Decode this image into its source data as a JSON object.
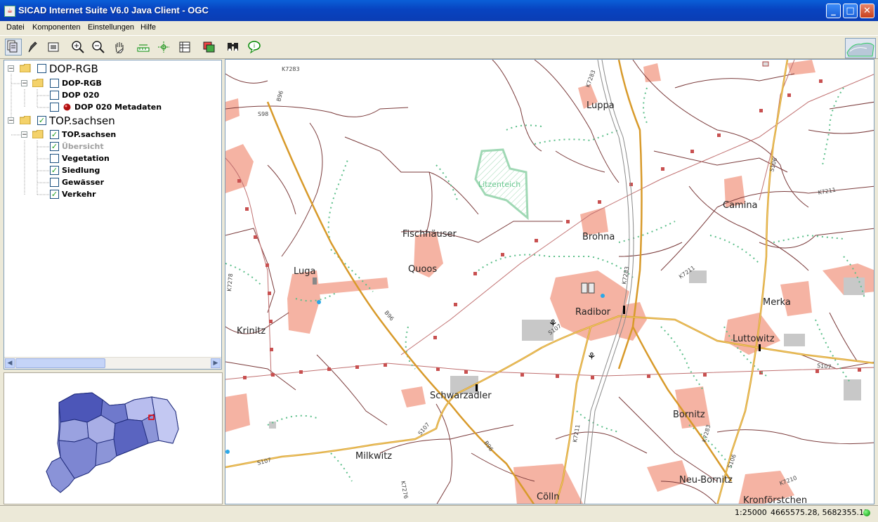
{
  "window": {
    "title": "SICAD Internet Suite V6.0 Java Client - OGC"
  },
  "menu": [
    "Datei",
    "Komponenten",
    "Einstellungen",
    "Hilfe"
  ],
  "tree": {
    "root1": {
      "label": "DOP-RGB",
      "checked": false
    },
    "root1_group": {
      "label": "DOP-RGB",
      "checked": false
    },
    "dop020": {
      "label": "DOP 020",
      "checked": false
    },
    "dop020meta": {
      "label": "DOP 020 Metadaten",
      "checked": false
    },
    "root2": {
      "label": "TOP.sachsen",
      "checked": true
    },
    "root2_group": {
      "label": "TOP.sachsen",
      "checked": true
    },
    "uebersicht": {
      "label": "Übersicht",
      "checked": true
    },
    "vegetation": {
      "label": "Vegetation",
      "checked": false
    },
    "siedlung": {
      "label": "Siedlung",
      "checked": true
    },
    "gewaesser": {
      "label": "Gewässer",
      "checked": false
    },
    "verkehr": {
      "label": "Verkehr",
      "checked": true
    }
  },
  "map": {
    "places": {
      "luppa": "Luppa",
      "camina": "Camina",
      "fischhaeuser": "Fischhäuser",
      "brohna": "Brohna",
      "luga": "Luga",
      "quoos": "Quoos",
      "radibor": "Radibor",
      "merka": "Merka",
      "krinitz": "Krinitz",
      "luttowitz": "Luttowitz",
      "schwarzadler": "Schwarzadler",
      "bornitz": "Bornitz",
      "milkwitz": "Milkwitz",
      "neu_bornitz": "Neu-Bornitz",
      "kronfoerstchen": "Kronförstchen",
      "coelln": "Cölln",
      "litzenteich": "Litzenteich"
    },
    "roads": {
      "k7283a": "K7283",
      "b96a": "B96",
      "s98": "S98",
      "k7283b": "K7283",
      "s106a": "S106",
      "k7211a": "K7211",
      "k7278": "K7278",
      "k7211b": "K7211",
      "k7283c": "K7283",
      "b96b": "B96",
      "s107a": "S107",
      "s107b": "S107",
      "s107c": "S107",
      "k7211c": "K7211",
      "k7283d": "K7283",
      "s107d": "S107",
      "b96c": "B96",
      "k7276": "K7276",
      "s106b": "S106",
      "k7210": "K7210"
    }
  },
  "status": {
    "scale": "1:25000",
    "coordinates": "4665575.28, 5682355.12"
  }
}
